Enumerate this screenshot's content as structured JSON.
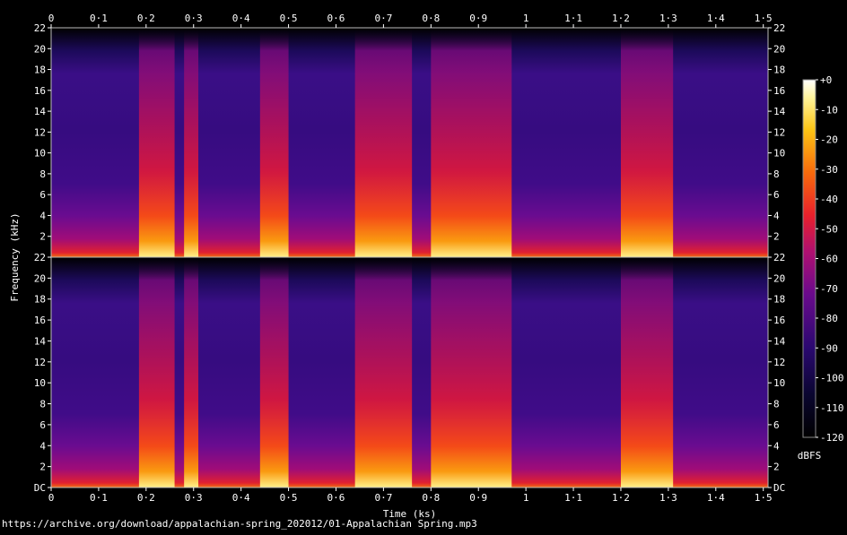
{
  "chart_data": {
    "type": "heatmap",
    "description_kind": "spectrogram",
    "source_text": "https://archive.org/download/appalachian-spring_202012/01-Appalachian Spring.mp3",
    "xlabel": "Time (ks)",
    "ylabel": "Frequency (kHz)",
    "xlim": [
      0,
      1.51
    ],
    "x_ticks": [
      "0",
      "0·1",
      "0·2",
      "0·3",
      "0·4",
      "0·5",
      "0·6",
      "0·7",
      "0·8",
      "0·9",
      "1",
      "1·1",
      "1·2",
      "1·3",
      "1·4",
      "1·5"
    ],
    "channels": [
      {
        "y_ticks": [
          "22",
          "20",
          "18",
          "16",
          "14",
          "12",
          "10",
          "8",
          "6",
          "4",
          "2"
        ]
      },
      {
        "y_ticks": [
          "22",
          "20",
          "18",
          "16",
          "14",
          "12",
          "10",
          "8",
          "6",
          "4",
          "2",
          "DC"
        ]
      }
    ],
    "ylim": [
      0,
      22
    ],
    "colorbar": {
      "label": "dBFS",
      "range": [
        -120,
        0
      ],
      "ticks": [
        "+0",
        "-10",
        "-20",
        "-30",
        "-40",
        "-50",
        "-60",
        "-70",
        "-80",
        "-90",
        "-100",
        "-110",
        "-120"
      ]
    },
    "loud_segments_ks": [
      [
        0.185,
        0.26
      ],
      [
        0.28,
        0.31
      ],
      [
        0.44,
        0.5
      ],
      [
        0.64,
        0.76
      ],
      [
        0.8,
        0.97
      ],
      [
        1.2,
        1.31
      ]
    ]
  }
}
